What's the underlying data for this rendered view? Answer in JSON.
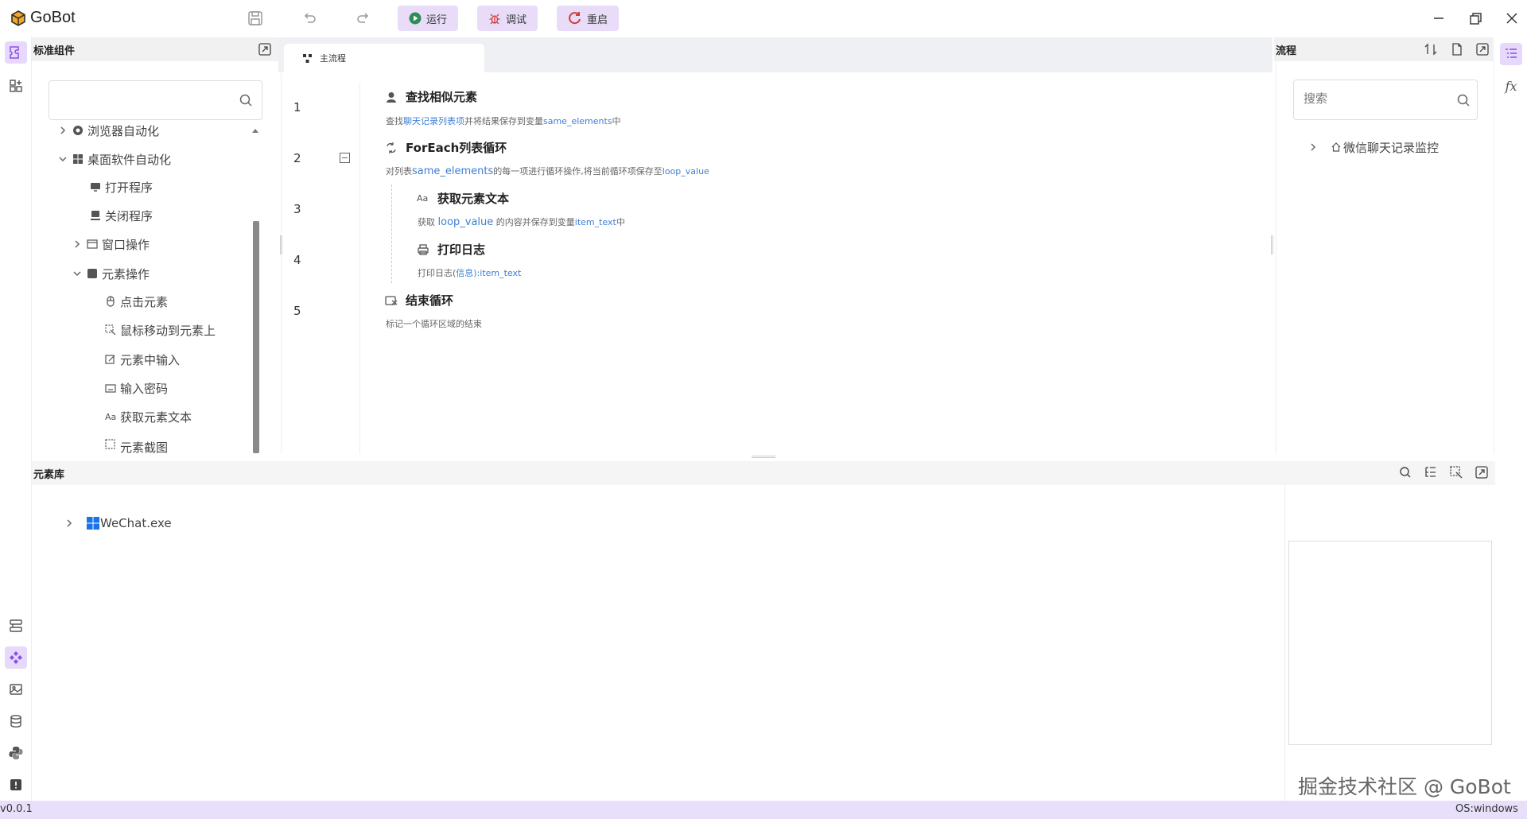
{
  "app": {
    "name": "GoBot"
  },
  "toolbar": {
    "run_label": "运行",
    "debug_label": "调试",
    "restart_label": "重启"
  },
  "left_panel": {
    "title": "标准组件",
    "search_placeholder": "",
    "tree": [
      {
        "label": "浏览器自动化",
        "icon": "chrome-icon"
      },
      {
        "label": "桌面软件自动化",
        "icon": "windows-icon"
      },
      {
        "label": "打开程序",
        "icon": "open-program-icon"
      },
      {
        "label": "关闭程序",
        "icon": "close-program-icon"
      },
      {
        "label": "窗口操作",
        "icon": "window-icon"
      },
      {
        "label": "元素操作",
        "icon": "element-icon"
      },
      {
        "label": "点击元素",
        "icon": "mouse-icon"
      },
      {
        "label": "鼠标移动到元素上",
        "icon": "hover-icon"
      },
      {
        "label": "元素中输入",
        "icon": "input-icon"
      },
      {
        "label": "输入密码",
        "icon": "password-icon"
      },
      {
        "label": "获取元素文本",
        "icon": "text-icon"
      },
      {
        "label": "元素截图",
        "icon": "screenshot-icon"
      }
    ]
  },
  "editor": {
    "tab_label": "主流程",
    "line_numbers": [
      "1",
      "2",
      "3",
      "4",
      "5"
    ],
    "steps": [
      {
        "title": "查找相似元素",
        "desc_parts": [
          "查找",
          "聊天记录列表项",
          "并将结果保存到变量",
          "same_elements",
          "中"
        ]
      },
      {
        "title": "ForEach列表循环",
        "desc_parts": [
          "对列表",
          "same_elements",
          "的每一项进行循环操作,将当前循环项保存至",
          "loop_value"
        ]
      },
      {
        "title": "获取元素文本",
        "desc_parts": [
          "获取 ",
          "loop_value",
          " 的内容并保存到变量",
          "item_text",
          "中"
        ]
      },
      {
        "title": "打印日志",
        "desc_parts": [
          "打印日志(",
          "信息",
          "):",
          "item_text"
        ]
      },
      {
        "title": "结束循环",
        "desc_parts": [
          "标记一个循环区域的结束"
        ]
      }
    ]
  },
  "right_panel": {
    "title": "流程",
    "search_placeholder": "搜索",
    "items": [
      {
        "label": "微信聊天记录监控"
      }
    ]
  },
  "element_lib": {
    "title": "元素库",
    "items": [
      {
        "label": "WeChat.exe"
      }
    ]
  },
  "watermark": "掘金技术社区 @ GoBot",
  "status": {
    "version": "v0.0.1",
    "os": "OS:windows"
  },
  "colors": {
    "accent": "#8a4fe6",
    "button_bg": "#e8dcf8",
    "link": "#3d7fd6",
    "status_bg": "#e8e0fa"
  }
}
